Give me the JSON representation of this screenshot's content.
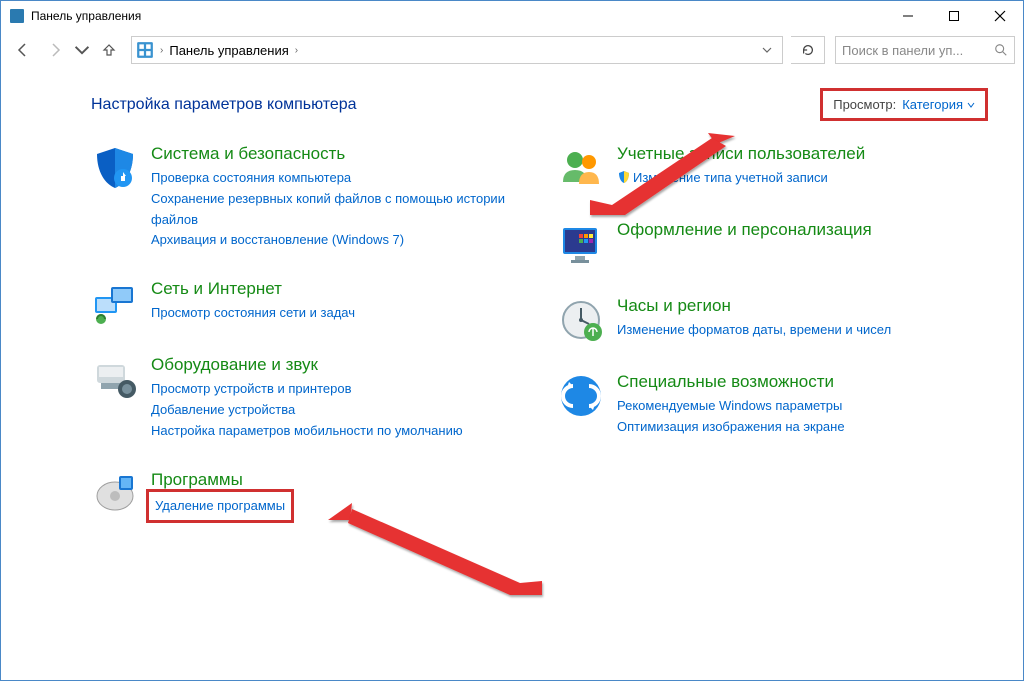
{
  "window": {
    "title": "Панель управления"
  },
  "nav": {
    "breadcrumb_root": "Панель управления",
    "search_placeholder": "Поиск в панели уп..."
  },
  "header": {
    "heading": "Настройка параметров компьютера",
    "view_label": "Просмотр:",
    "view_value": "Категория"
  },
  "categories_left": [
    {
      "title": "Система и безопасность",
      "links": [
        {
          "label": "Проверка состояния компьютера",
          "shield": false
        },
        {
          "label": "Сохранение резервных копий файлов с помощью истории файлов",
          "shield": false
        },
        {
          "label": "Архивация и восстановление (Windows 7)",
          "shield": false
        }
      ]
    },
    {
      "title": "Сеть и Интернет",
      "links": [
        {
          "label": "Просмотр состояния сети и задач",
          "shield": false
        }
      ]
    },
    {
      "title": "Оборудование и звук",
      "links": [
        {
          "label": "Просмотр устройств и принтеров",
          "shield": false
        },
        {
          "label": "Добавление устройства",
          "shield": false
        },
        {
          "label": "Настройка параметров мобильности по умолчанию",
          "shield": false
        }
      ]
    },
    {
      "title": "Программы",
      "links": [
        {
          "label": "Удаление программы",
          "shield": false,
          "highlight": true
        }
      ]
    }
  ],
  "categories_right": [
    {
      "title": "Учетные записи пользователей",
      "links": [
        {
          "label": "Изменение типа учетной записи",
          "shield": true
        }
      ]
    },
    {
      "title": "Оформление и персонализация",
      "links": []
    },
    {
      "title": "Часы и регион",
      "links": [
        {
          "label": "Изменение форматов даты, времени и чисел",
          "shield": false
        }
      ]
    },
    {
      "title": "Специальные возможности",
      "links": [
        {
          "label": "Рекомендуемые Windows параметры",
          "shield": false
        },
        {
          "label": "Оптимизация изображения на экране",
          "shield": false
        }
      ]
    }
  ],
  "icons_left": [
    "shield",
    "network",
    "hardware",
    "programs"
  ],
  "icons_right": [
    "users",
    "personalization",
    "clock",
    "accessibility"
  ]
}
